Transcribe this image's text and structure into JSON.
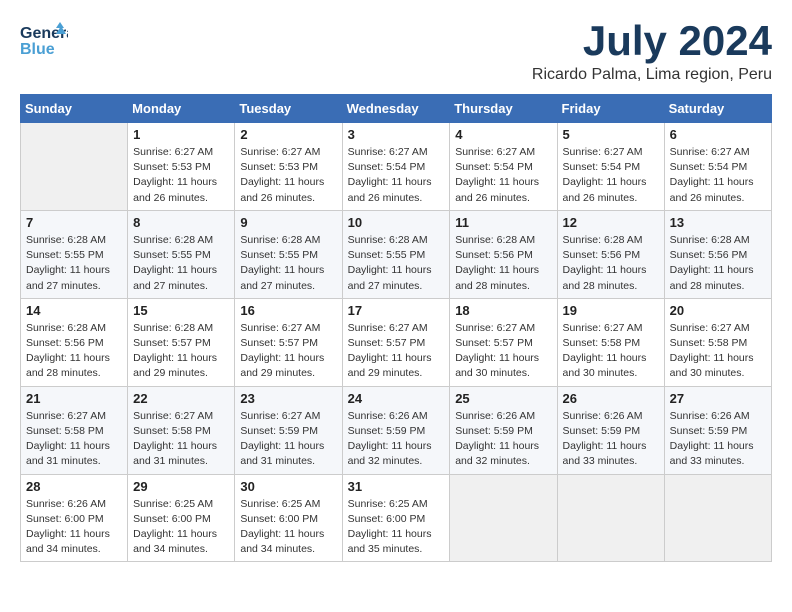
{
  "header": {
    "logo_line1": "General",
    "logo_line2": "Blue",
    "month_title": "July 2024",
    "subtitle": "Ricardo Palma, Lima region, Peru"
  },
  "days_of_week": [
    "Sunday",
    "Monday",
    "Tuesday",
    "Wednesday",
    "Thursday",
    "Friday",
    "Saturday"
  ],
  "weeks": [
    [
      {
        "num": "",
        "info": ""
      },
      {
        "num": "1",
        "info": "Sunrise: 6:27 AM\nSunset: 5:53 PM\nDaylight: 11 hours\nand 26 minutes."
      },
      {
        "num": "2",
        "info": "Sunrise: 6:27 AM\nSunset: 5:53 PM\nDaylight: 11 hours\nand 26 minutes."
      },
      {
        "num": "3",
        "info": "Sunrise: 6:27 AM\nSunset: 5:54 PM\nDaylight: 11 hours\nand 26 minutes."
      },
      {
        "num": "4",
        "info": "Sunrise: 6:27 AM\nSunset: 5:54 PM\nDaylight: 11 hours\nand 26 minutes."
      },
      {
        "num": "5",
        "info": "Sunrise: 6:27 AM\nSunset: 5:54 PM\nDaylight: 11 hours\nand 26 minutes."
      },
      {
        "num": "6",
        "info": "Sunrise: 6:27 AM\nSunset: 5:54 PM\nDaylight: 11 hours\nand 26 minutes."
      }
    ],
    [
      {
        "num": "7",
        "info": "Sunrise: 6:28 AM\nSunset: 5:55 PM\nDaylight: 11 hours\nand 27 minutes."
      },
      {
        "num": "8",
        "info": "Sunrise: 6:28 AM\nSunset: 5:55 PM\nDaylight: 11 hours\nand 27 minutes."
      },
      {
        "num": "9",
        "info": "Sunrise: 6:28 AM\nSunset: 5:55 PM\nDaylight: 11 hours\nand 27 minutes."
      },
      {
        "num": "10",
        "info": "Sunrise: 6:28 AM\nSunset: 5:55 PM\nDaylight: 11 hours\nand 27 minutes."
      },
      {
        "num": "11",
        "info": "Sunrise: 6:28 AM\nSunset: 5:56 PM\nDaylight: 11 hours\nand 28 minutes."
      },
      {
        "num": "12",
        "info": "Sunrise: 6:28 AM\nSunset: 5:56 PM\nDaylight: 11 hours\nand 28 minutes."
      },
      {
        "num": "13",
        "info": "Sunrise: 6:28 AM\nSunset: 5:56 PM\nDaylight: 11 hours\nand 28 minutes."
      }
    ],
    [
      {
        "num": "14",
        "info": "Sunrise: 6:28 AM\nSunset: 5:56 PM\nDaylight: 11 hours\nand 28 minutes."
      },
      {
        "num": "15",
        "info": "Sunrise: 6:28 AM\nSunset: 5:57 PM\nDaylight: 11 hours\nand 29 minutes."
      },
      {
        "num": "16",
        "info": "Sunrise: 6:27 AM\nSunset: 5:57 PM\nDaylight: 11 hours\nand 29 minutes."
      },
      {
        "num": "17",
        "info": "Sunrise: 6:27 AM\nSunset: 5:57 PM\nDaylight: 11 hours\nand 29 minutes."
      },
      {
        "num": "18",
        "info": "Sunrise: 6:27 AM\nSunset: 5:57 PM\nDaylight: 11 hours\nand 30 minutes."
      },
      {
        "num": "19",
        "info": "Sunrise: 6:27 AM\nSunset: 5:58 PM\nDaylight: 11 hours\nand 30 minutes."
      },
      {
        "num": "20",
        "info": "Sunrise: 6:27 AM\nSunset: 5:58 PM\nDaylight: 11 hours\nand 30 minutes."
      }
    ],
    [
      {
        "num": "21",
        "info": "Sunrise: 6:27 AM\nSunset: 5:58 PM\nDaylight: 11 hours\nand 31 minutes."
      },
      {
        "num": "22",
        "info": "Sunrise: 6:27 AM\nSunset: 5:58 PM\nDaylight: 11 hours\nand 31 minutes."
      },
      {
        "num": "23",
        "info": "Sunrise: 6:27 AM\nSunset: 5:59 PM\nDaylight: 11 hours\nand 31 minutes."
      },
      {
        "num": "24",
        "info": "Sunrise: 6:26 AM\nSunset: 5:59 PM\nDaylight: 11 hours\nand 32 minutes."
      },
      {
        "num": "25",
        "info": "Sunrise: 6:26 AM\nSunset: 5:59 PM\nDaylight: 11 hours\nand 32 minutes."
      },
      {
        "num": "26",
        "info": "Sunrise: 6:26 AM\nSunset: 5:59 PM\nDaylight: 11 hours\nand 33 minutes."
      },
      {
        "num": "27",
        "info": "Sunrise: 6:26 AM\nSunset: 5:59 PM\nDaylight: 11 hours\nand 33 minutes."
      }
    ],
    [
      {
        "num": "28",
        "info": "Sunrise: 6:26 AM\nSunset: 6:00 PM\nDaylight: 11 hours\nand 34 minutes."
      },
      {
        "num": "29",
        "info": "Sunrise: 6:25 AM\nSunset: 6:00 PM\nDaylight: 11 hours\nand 34 minutes."
      },
      {
        "num": "30",
        "info": "Sunrise: 6:25 AM\nSunset: 6:00 PM\nDaylight: 11 hours\nand 34 minutes."
      },
      {
        "num": "31",
        "info": "Sunrise: 6:25 AM\nSunset: 6:00 PM\nDaylight: 11 hours\nand 35 minutes."
      },
      {
        "num": "",
        "info": ""
      },
      {
        "num": "",
        "info": ""
      },
      {
        "num": "",
        "info": ""
      }
    ]
  ]
}
